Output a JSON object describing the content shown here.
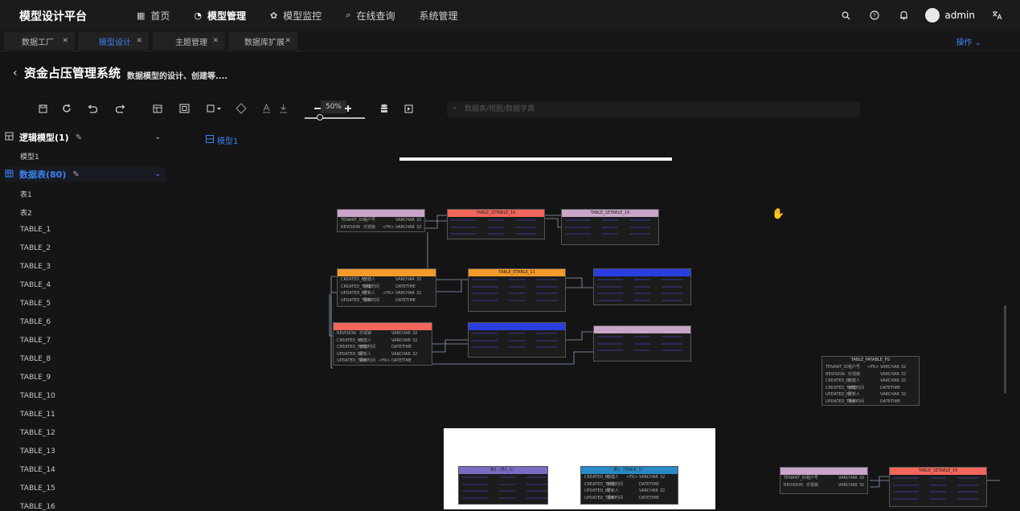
{
  "app": {
    "brand": "模型设计平台"
  },
  "nav": [
    {
      "icon": "grid-icon",
      "glyph": "▦",
      "label": "首页"
    },
    {
      "icon": "pie-chart-icon",
      "glyph": "◔",
      "label": "模型管理"
    },
    {
      "icon": "gear-icon",
      "glyph": "✿",
      "label": "模型监控"
    },
    {
      "icon": "search-icon",
      "glyph": "⌕",
      "label": "在线查询"
    },
    {
      "icon": "",
      "glyph": "",
      "label": "系统管理"
    }
  ],
  "user": {
    "name": "admin"
  },
  "tabs": [
    {
      "label": "数据工厂"
    },
    {
      "label": "模型设计"
    },
    {
      "label": "主题管理"
    },
    {
      "label": "数据库扩展"
    }
  ],
  "ops": "操作 ⌄",
  "page": {
    "title": "资金占压管理系统",
    "subtitle": "数据模型的设计、创建等...."
  },
  "toolbar": {
    "zoom": "50%",
    "search_placeholder": "数据表/视图/数据字典"
  },
  "sidebar": {
    "logic": "逻辑模型(1)",
    "model1": "模型1",
    "tables_group": "数据表(80)",
    "items": [
      "表1",
      "表2",
      "TABLE_1",
      "TABLE_2",
      "TABLE_3",
      "TABLE_4",
      "TABLE_5",
      "TABLE_6",
      "TABLE_7",
      "TABLE_8",
      "TABLE_9",
      "TABLE_10",
      "TABLE_11",
      "TABLE_12",
      "TABLE_13",
      "TABLE_14",
      "TABLE_15",
      "TABLE_16"
    ]
  },
  "canvas": {
    "model_tab": "模型1"
  },
  "colors": {
    "accent": "#3a82f0",
    "pink": "#c9a6c9",
    "red": "#f2665c",
    "orange": "#f39a2a",
    "blue": "#2a3ee0",
    "purple": "#7b6bc2",
    "teal": "#2a8ac6"
  },
  "entities": [
    {
      "header": "",
      "color": "#c9a6c9",
      "rows": [
        [
          "TENANT_ID",
          "租户号",
          "",
          "VARCHAR",
          "32"
        ],
        [
          "REVISION",
          "乐观锁",
          "<FK>",
          "VARCHAR",
          "32"
        ]
      ]
    },
    {
      "header": "TABLE_1ETABLE_16",
      "color": "#f2665c",
      "rows": []
    },
    {
      "header": "TABLE_1ETABLE_16",
      "color": "#c9a6c9",
      "rows": []
    },
    {
      "header": "",
      "color": "#f39a2a",
      "rows": [
        [
          "CREATED_BY",
          "创建人",
          "",
          "VARCHAR",
          "32"
        ],
        [
          "CREATED_TIME",
          "创建时间",
          "",
          "DATETIME",
          ""
        ],
        [
          "UPDATED_BY",
          "更新人",
          "<FK>",
          "VARCHAR",
          "32"
        ],
        [
          "UPDATED_TIME",
          "更新时间",
          "",
          "DATETIME",
          ""
        ]
      ]
    },
    {
      "header": "TABLE_ETABLE_11",
      "color": "#f39a2a",
      "rows": []
    },
    {
      "header": "",
      "color": "#2a3ee0",
      "rows": []
    },
    {
      "header": "",
      "color": "#f2665c",
      "rows": [
        [
          "REVISION",
          "乐观锁",
          "",
          "VARCHAR",
          "32"
        ],
        [
          "CREATED_BY",
          "创建人",
          "",
          "VARCHAR",
          "32"
        ],
        [
          "CREATED_TIME",
          "创建时间",
          "",
          "DATETIME",
          ""
        ],
        [
          "UPDATED_BY",
          "更新人",
          "",
          "VARCHAR",
          "32"
        ],
        [
          "UPDATED_TIME",
          "更新时间",
          "<FK>",
          "DATETIME",
          ""
        ]
      ]
    },
    {
      "header": "",
      "color": "#2a3ee0",
      "rows": []
    },
    {
      "header": "",
      "color": "#c9a6c9",
      "rows": []
    },
    {
      "header": "TABLE_PATABLE_FG",
      "color": "#1c1c1c",
      "rows": [
        [
          "TENANT_ID",
          "租户号",
          "<FK>",
          "VARCHAR",
          "32"
        ],
        [
          "REVISION",
          "乐观锁",
          "",
          "VARCHAR",
          "32"
        ],
        [
          "CREATED_BY",
          "创建人",
          "",
          "VARCHAR",
          "32"
        ],
        [
          "CREATED_TIME",
          "创建时间",
          "",
          "DATETIME",
          ""
        ],
        [
          "UPDATED_BY",
          "更新人",
          "",
          "VARCHAR",
          "32"
        ],
        [
          "UPDATED_TIME",
          "更新时间",
          "",
          "DATETIME",
          ""
        ]
      ]
    },
    {
      "header": "表1（表1_1）",
      "color": "#7b6bc2",
      "rows": []
    },
    {
      "header": "表1（TABLE_1）",
      "color": "#2a8ac6",
      "rows": [
        [
          "CREATED_BY",
          "创建人",
          "<FK>",
          "VARCHAR",
          "32"
        ],
        [
          "CREATED_TIME",
          "创建时间",
          "",
          "DATETIME",
          ""
        ],
        [
          "UPDATED_BY",
          "更新人",
          "",
          "VARCHAR",
          "32"
        ],
        [
          "UPDATED_TIME",
          "更新时间",
          "",
          "DATETIME",
          ""
        ]
      ]
    },
    {
      "header": "",
      "color": "#c9a6c9",
      "rows": [
        [
          "TENANT_ID",
          "租户号",
          "",
          "VARCHAR",
          "32"
        ],
        [
          "REVISION",
          "乐观锁",
          "",
          "VARCHAR",
          "32"
        ]
      ]
    },
    {
      "header": "TABLE_1ETABLE_16",
      "color": "#f2665c",
      "rows": []
    }
  ]
}
